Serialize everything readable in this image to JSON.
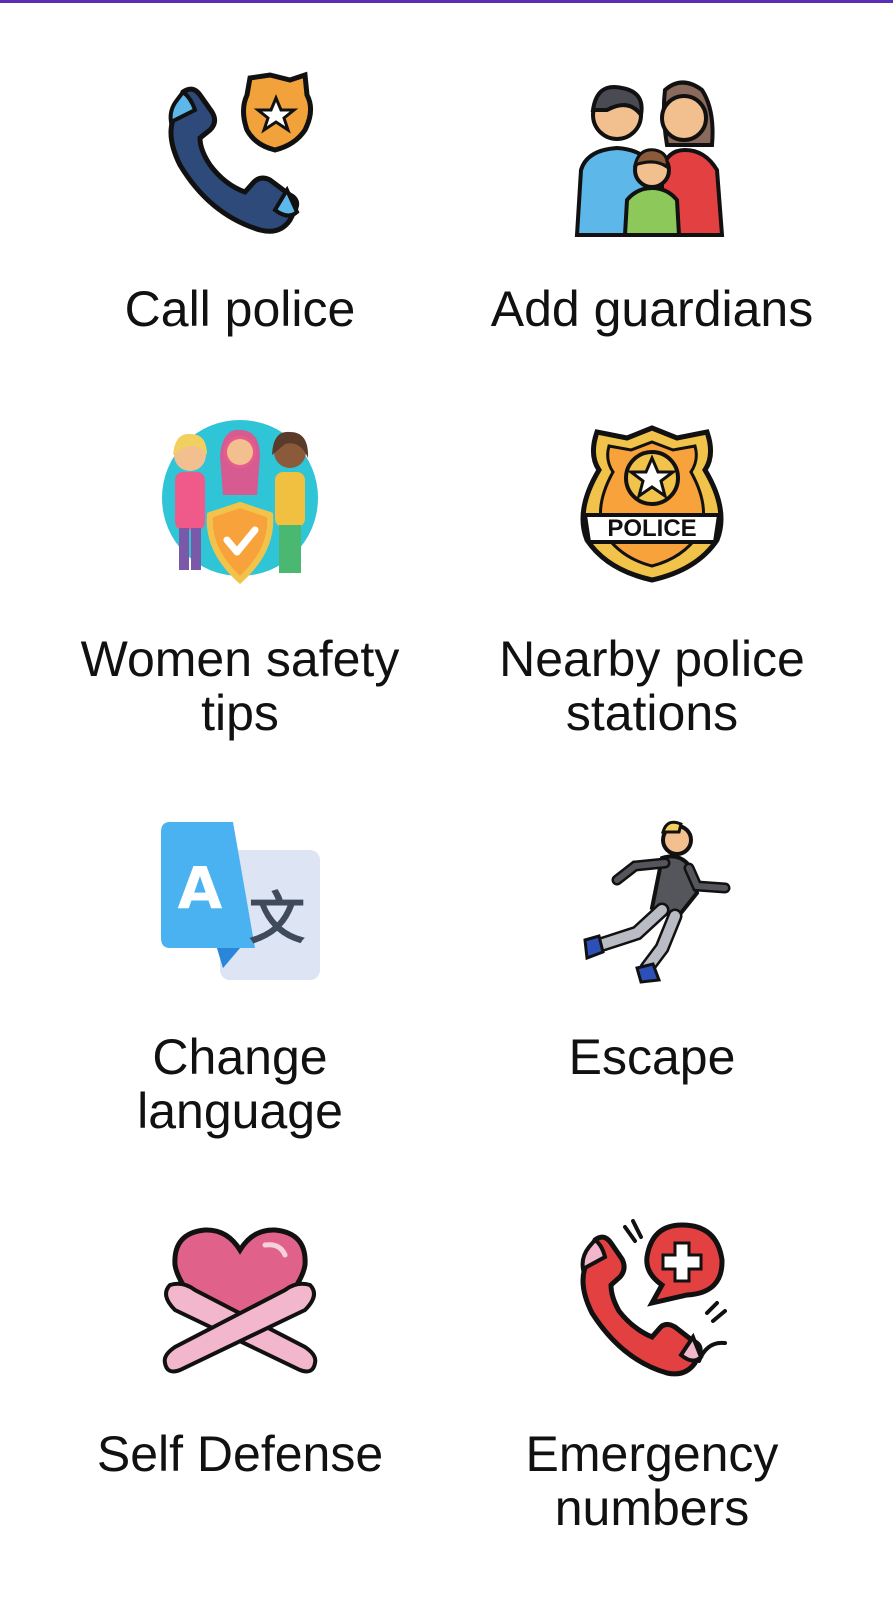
{
  "menu": {
    "items": [
      {
        "label": "Call police",
        "icon": "police-phone-icon"
      },
      {
        "label": "Add guardians",
        "icon": "family-icon"
      },
      {
        "label": "Women safety tips",
        "icon": "women-shield-icon"
      },
      {
        "label": "Nearby police stations",
        "icon": "police-badge-icon"
      },
      {
        "label": "Change language",
        "icon": "translate-icon"
      },
      {
        "label": "Escape",
        "icon": "running-woman-icon"
      },
      {
        "label": "Self Defense",
        "icon": "heart-hug-icon"
      },
      {
        "label": "Emergency numbers",
        "icon": "emergency-call-icon"
      }
    ]
  },
  "badge_text": "POLICE",
  "translate_letter": "A",
  "translate_glyph": "文"
}
